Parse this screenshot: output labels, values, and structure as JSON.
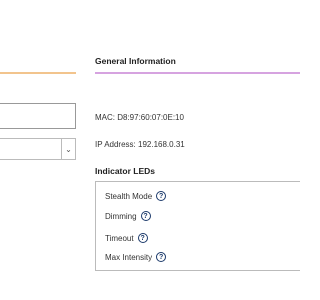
{
  "general_information": {
    "title": "General Information",
    "mac_label": "MAC:",
    "mac_value": "D8:97:60:07:0E:10",
    "ip_label": "IP Address:",
    "ip_value": "192.168.0.31"
  },
  "indicator_leds": {
    "title": "Indicator LEDs",
    "items": [
      {
        "label": "Stealth Mode",
        "icon": "help-icon"
      },
      {
        "label": "Dimming",
        "icon": "help-icon"
      },
      {
        "label": "Timeout",
        "icon": "help-icon"
      },
      {
        "label": "Max Intensity",
        "icon": "help-icon"
      }
    ]
  },
  "left_form": {
    "text_input_value": "",
    "select_value": ""
  },
  "colors": {
    "left_underline": "#f2c48d",
    "right_underline": "#d6a3e0",
    "help_icon": "#1c3a6b"
  }
}
